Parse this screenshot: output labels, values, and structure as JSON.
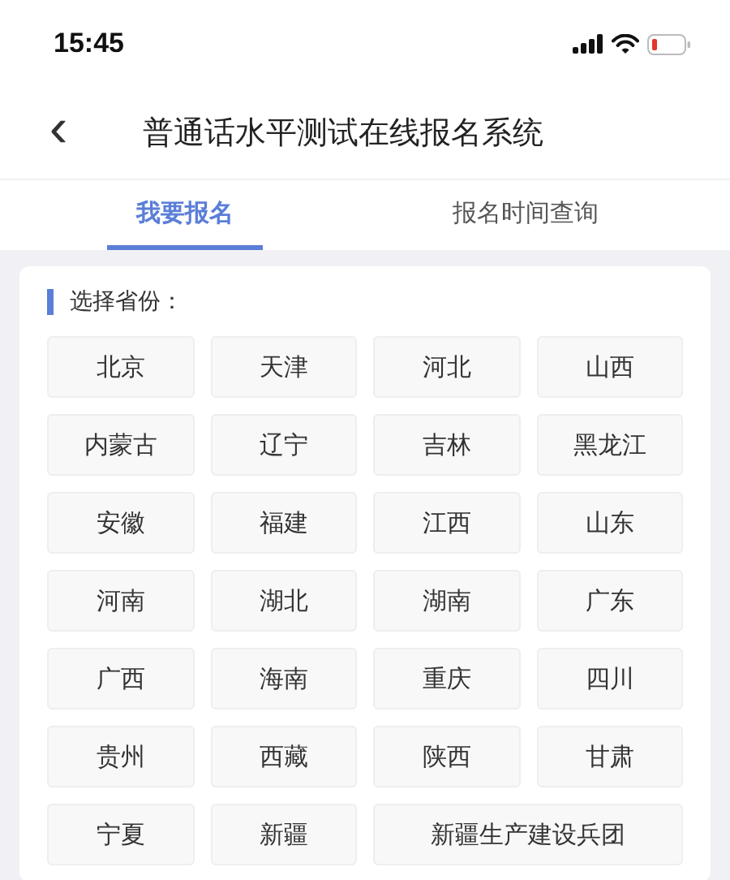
{
  "status_bar": {
    "time": "15:45"
  },
  "header": {
    "back": "‹",
    "title": "普通话水平测试在线报名系统"
  },
  "tabs": [
    {
      "label": "我要报名",
      "selected": true
    },
    {
      "label": "报名时间查询",
      "selected": false
    }
  ],
  "section": {
    "heading": "选择省份："
  },
  "provinces": [
    {
      "name": "北京",
      "kind": "normal"
    },
    {
      "name": "天津",
      "kind": "normal"
    },
    {
      "name": "河北",
      "kind": "normal"
    },
    {
      "name": "山西",
      "kind": "normal"
    },
    {
      "name": "内蒙古",
      "kind": "normal"
    },
    {
      "name": "辽宁",
      "kind": "normal"
    },
    {
      "name": "吉林",
      "kind": "normal"
    },
    {
      "name": "黑龙江",
      "kind": "normal"
    },
    {
      "name": "安徽",
      "kind": "normal"
    },
    {
      "name": "福建",
      "kind": "normal"
    },
    {
      "name": "江西",
      "kind": "normal"
    },
    {
      "name": "山东",
      "kind": "normal"
    },
    {
      "name": "河南",
      "kind": "normal"
    },
    {
      "name": "湖北",
      "kind": "normal"
    },
    {
      "name": "湖南",
      "kind": "normal"
    },
    {
      "name": "广东",
      "kind": "normal"
    },
    {
      "name": "广西",
      "kind": "normal"
    },
    {
      "name": "海南",
      "kind": "normal"
    },
    {
      "name": "重庆",
      "kind": "normal"
    },
    {
      "name": "四川",
      "kind": "normal"
    },
    {
      "name": "贵州",
      "kind": "normal"
    },
    {
      "name": "西藏",
      "kind": "normal"
    },
    {
      "name": "陕西",
      "kind": "normal"
    },
    {
      "name": "甘肃",
      "kind": "normal"
    },
    {
      "name": "宁夏",
      "kind": "normal"
    },
    {
      "name": "新疆",
      "kind": "normal"
    },
    {
      "name": "新疆生产建设兵团",
      "kind": "wide"
    }
  ]
}
